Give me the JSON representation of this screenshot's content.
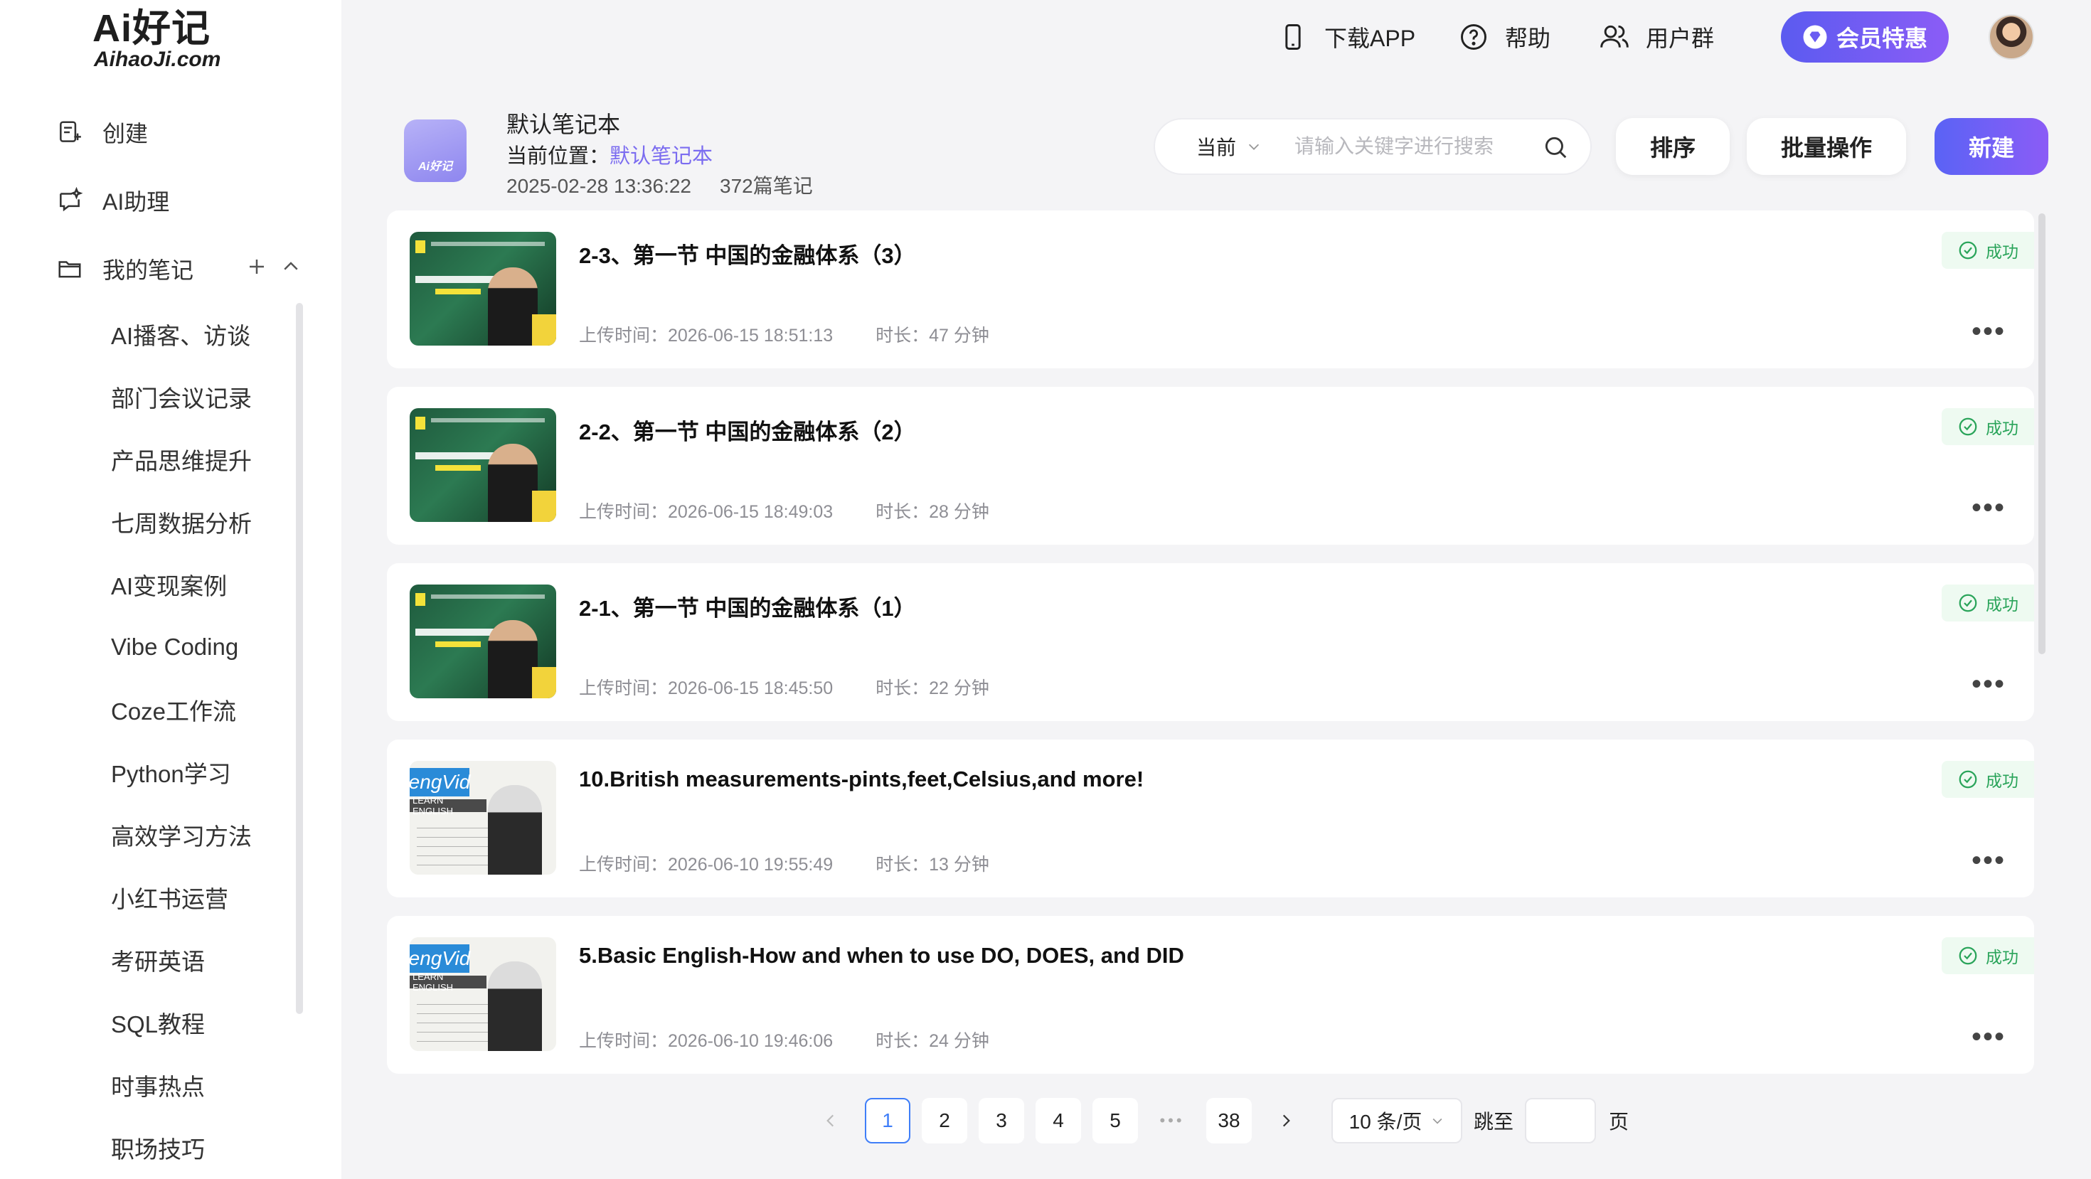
{
  "brand": {
    "logo_main": "Ai好记",
    "logo_sub": "AihaoJi.com"
  },
  "sidebar": {
    "create_label": "创建",
    "ai_assistant_label": "AI助理",
    "my_notes_label": "我的笔记",
    "folders": [
      "AI播客、访谈",
      "部门会议记录",
      "产品思维提升",
      "七周数据分析",
      "AI变现案例",
      "Vibe Coding",
      "Coze工作流",
      "Python学习",
      "高效学习方法",
      "小红书运营",
      "考研英语",
      "SQL教程",
      "时事热点",
      "职场技巧"
    ]
  },
  "topbar": {
    "download_app": "下载APP",
    "help": "帮助",
    "user_group": "用户群",
    "vip_label": "会员特惠"
  },
  "notebook": {
    "title": "默认笔记本",
    "location_prefix": "当前位置：",
    "location_link": "默认笔记本",
    "created_at": "2025-02-28 13:36:22",
    "count": "372篇笔记"
  },
  "search": {
    "scope": "当前",
    "placeholder": "请输入关键字进行搜索"
  },
  "actions": {
    "sort": "排序",
    "batch": "批量操作",
    "new": "新建"
  },
  "notes": [
    {
      "title": "2-3、第一节 中国的金融体系（3）",
      "upload": "上传时间：2026-06-15 18:51:13",
      "duration": "时长：47 分钟",
      "status": "成功",
      "thumb": "finance"
    },
    {
      "title": "2-2、第一节 中国的金融体系（2）",
      "upload": "上传时间：2026-06-15 18:49:03",
      "duration": "时长：28 分钟",
      "status": "成功",
      "thumb": "finance"
    },
    {
      "title": "2-1、第一节 中国的金融体系（1）",
      "upload": "上传时间：2026-06-15 18:45:50",
      "duration": "时长：22 分钟",
      "status": "成功",
      "thumb": "finance"
    },
    {
      "title": "10.British measurements-pints,feet,Celsius,and more!",
      "upload": "上传时间：2026-06-10 19:55:49",
      "duration": "时长：13 分钟",
      "status": "成功",
      "thumb": "engvid"
    },
    {
      "title": "5.Basic English-How and when to use DO, DOES, and DID",
      "upload": "上传时间：2026-06-10 19:46:06",
      "duration": "时长：24 分钟",
      "status": "成功",
      "thumb": "engvid"
    }
  ],
  "thumb_text": {
    "engvid_logo": "engVid",
    "engvid_learn": "LEARN ENGLISH",
    "notebook_icon": "Ai好记"
  },
  "pagination": {
    "pages": [
      "1",
      "2",
      "3",
      "4",
      "5"
    ],
    "ellipsis": "•••",
    "last": "38",
    "current": "1",
    "per_page": "10 条/页",
    "jump_label": "跳至",
    "page_suffix": "页"
  },
  "colors": {
    "accent": "#7b6cf0",
    "primary_gradient_start": "#5a63f5",
    "primary_gradient_end": "#8b5cf6",
    "success": "#2aa45a",
    "pager_active": "#3f7ef8"
  }
}
